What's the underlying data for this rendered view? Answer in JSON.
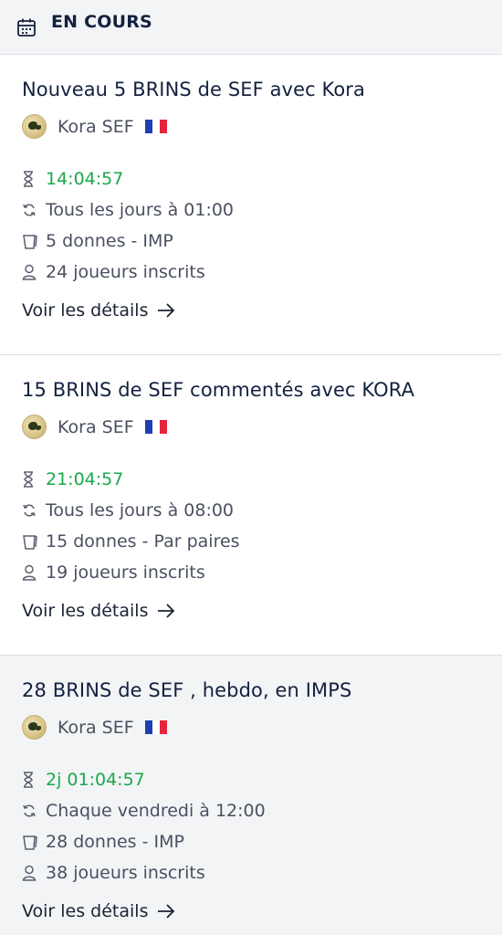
{
  "header": {
    "title": "EN COURS",
    "icon": "calendar-icon"
  },
  "cards": [
    {
      "name": "Nouveau 5 BRINS de SEF avec Kora",
      "organizer": "Kora SEF",
      "timer": "14:04:57",
      "schedule": "Tous les jours à 01:00",
      "deals": "5 donnes - IMP",
      "players": "24 joueurs inscrits",
      "details_label": "Voir les détails"
    },
    {
      "name": "15 BRINS de SEF commentés avec KORA",
      "organizer": "Kora SEF",
      "timer": "21:04:57",
      "schedule": "Tous les jours à 08:00",
      "deals": "15 donnes - Par paires",
      "players": "19 joueurs inscrits",
      "details_label": "Voir les détails"
    },
    {
      "name": "28 BRINS de SEF , hebdo, en IMPS",
      "organizer": "Kora SEF",
      "timer": "2j 01:04:57",
      "schedule": "Chaque vendredi à 12:00",
      "deals": "28 donnes - IMP",
      "players": "38 joueurs inscrits",
      "details_label": "Voir les détails"
    }
  ],
  "colors": {
    "timer": "#1aa84a",
    "title": "#13213f",
    "text": "#4a5060",
    "header_bg": "#f3f4f6"
  }
}
